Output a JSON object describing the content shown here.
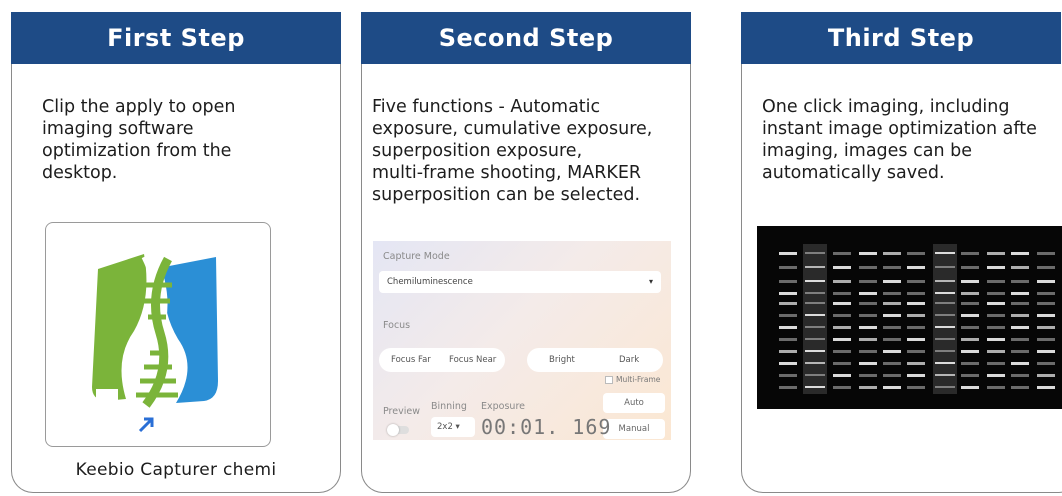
{
  "steps": [
    {
      "header": "First Step",
      "description": "Clip the apply to open\nimaging software\noptimization from  the\ndesktop.",
      "app_caption": "Keebio Capturer chemi"
    },
    {
      "header": "Second Step",
      "description": "Five functions - Automatic\nexposure, cumulative exposure,\nsuperposition exposure,\nmulti-frame shooting, MARKER\nsuperposition can be selected.",
      "capture": {
        "mode_label": "Capture Mode",
        "mode_value": "Chemiluminescence",
        "focus_label": "Focus",
        "focus_far": "Focus Far",
        "focus_near": "Focus Near",
        "bright": "Bright",
        "dark": "Dark",
        "multi_frame": "Multi-Frame",
        "preview_label": "Preview",
        "binning_label": "Binning",
        "exposure_label": "Exposure",
        "binning_value": "2x2",
        "exposure_time": "00:01. 169",
        "auto": "Auto",
        "manual": "Manual"
      }
    },
    {
      "header": "Third Step",
      "description": "One click imaging, including\ninstant image optimization afte\nimaging, images can be\nautomatically saved."
    }
  ],
  "colors": {
    "header_bg": "#1e4b86",
    "logo_green": "#7bb43a",
    "logo_blue": "#2b8fd6",
    "gel_bg": "#060606"
  }
}
